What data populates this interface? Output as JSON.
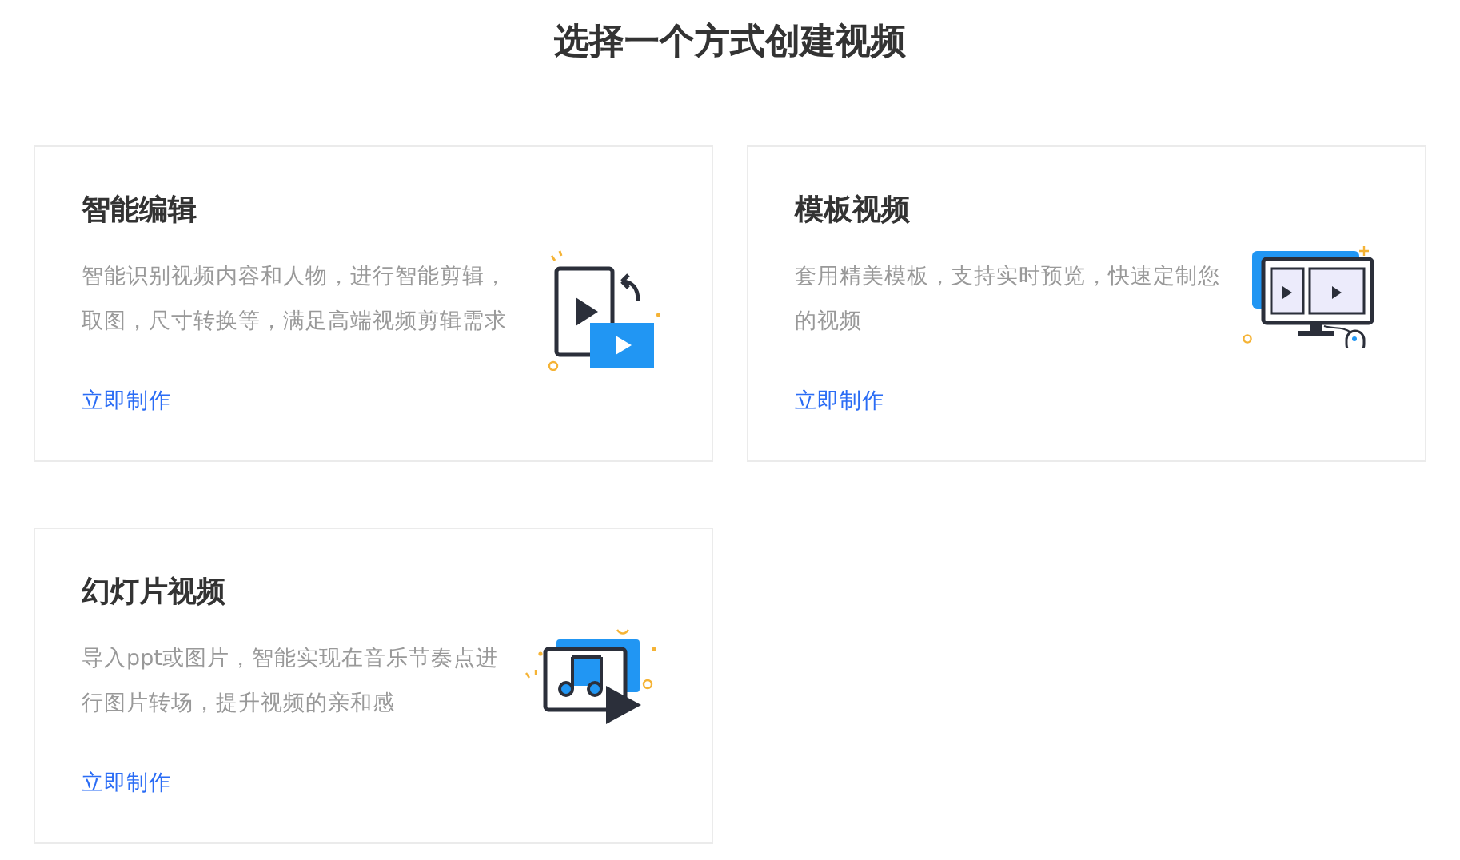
{
  "title": "选择一个方式创建视频",
  "cards": [
    {
      "kind": "edit",
      "title": "智能编辑",
      "description": "智能识别视频内容和人物，进行智能剪辑，取图，尺寸转换等，满足高端视频剪辑需求",
      "link": "立即制作"
    },
    {
      "kind": "template",
      "title": "模板视频",
      "description": "套用精美模板，支持实时预览，快速定制您的视频",
      "link": "立即制作"
    },
    {
      "kind": "slideshow",
      "title": "幻灯片视频",
      "description": "导入ppt或图片，智能实现在音乐节奏点进行图片转场，提升视频的亲和感",
      "link": "立即制作"
    }
  ]
}
